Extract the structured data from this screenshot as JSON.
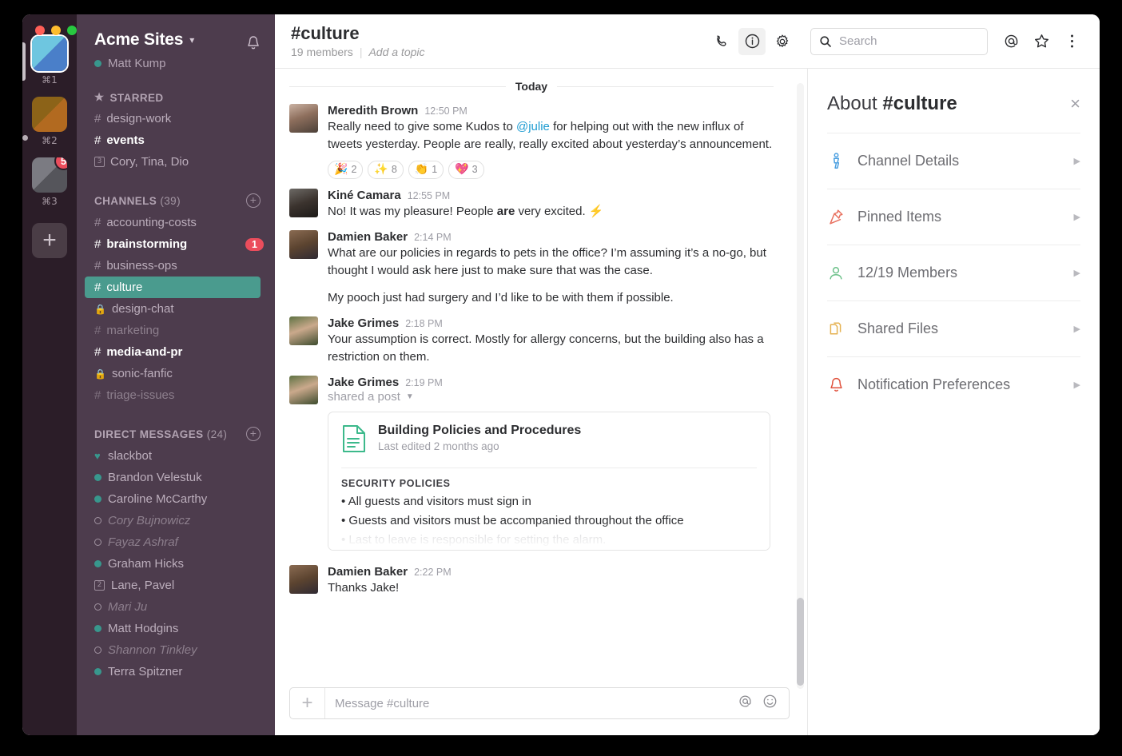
{
  "window": {
    "traffic_lights": [
      {
        "name": "close",
        "color": "#ff5f57"
      },
      {
        "name": "minimize",
        "color": "#febc2e"
      },
      {
        "name": "zoom",
        "color": "#28c840"
      }
    ]
  },
  "rail": {
    "workspaces": [
      {
        "name": "workspace-1",
        "shortcut": "⌘1",
        "color_a": "#6ec6e0",
        "color_b": "#4a7fc9",
        "selected": true,
        "badge": null
      },
      {
        "name": "workspace-2",
        "shortcut": "⌘2",
        "color_a": "#8c6318",
        "color_b": "#b26a20",
        "selected": false,
        "badge": null
      },
      {
        "name": "workspace-3",
        "shortcut": "⌘3",
        "color_a": "#7b7b82",
        "color_b": "#55555b",
        "selected": false,
        "badge": "5"
      }
    ],
    "add_label": "+"
  },
  "sidebar": {
    "team_name": "Acme Sites",
    "team_caret": "⌄",
    "bell_icon": "bell-icon",
    "user_name": "Matt Kump",
    "starred": {
      "label": "STARRED",
      "items": [
        {
          "sigil": "#",
          "label": "design-work",
          "state": "normal",
          "badge": null
        },
        {
          "sigil": "#",
          "label": "events",
          "state": "unread",
          "badge": null
        },
        {
          "sigil": "3",
          "label": "Cory, Tina, Dio",
          "state": "group",
          "badge": null
        }
      ]
    },
    "channels": {
      "label": "CHANNELS",
      "count": "(39)",
      "add_label": "+",
      "items": [
        {
          "sigil": "#",
          "label": "accounting-costs",
          "state": "normal",
          "badge": null
        },
        {
          "sigil": "#",
          "label": "brainstorming",
          "state": "unread",
          "badge": "1"
        },
        {
          "sigil": "#",
          "label": "business-ops",
          "state": "normal",
          "badge": null
        },
        {
          "sigil": "#",
          "label": "culture",
          "state": "active",
          "badge": null
        },
        {
          "sigil": "lock",
          "label": "design-chat",
          "state": "normal",
          "badge": null
        },
        {
          "sigil": "#",
          "label": "marketing",
          "state": "muted",
          "badge": null
        },
        {
          "sigil": "#",
          "label": "media-and-pr",
          "state": "unread",
          "badge": null
        },
        {
          "sigil": "lock",
          "label": "sonic-fanfic",
          "state": "normal",
          "badge": null
        },
        {
          "sigil": "#",
          "label": "triage-issues",
          "state": "muted",
          "badge": null
        }
      ]
    },
    "direct_messages": {
      "label": "DIRECT MESSAGES",
      "count": "(24)",
      "add_label": "+",
      "items": [
        {
          "label": "slackbot",
          "presence": "heart"
        },
        {
          "label": "Brandon Velestuk",
          "presence": "online"
        },
        {
          "label": "Caroline McCarthy",
          "presence": "online"
        },
        {
          "label": "Cory Bujnowicz",
          "presence": "away"
        },
        {
          "label": "Fayaz Ashraf",
          "presence": "away"
        },
        {
          "label": "Graham Hicks",
          "presence": "online"
        },
        {
          "label": "Lane, Pavel",
          "presence": "group2"
        },
        {
          "label": "Mari Ju",
          "presence": "away"
        },
        {
          "label": "Matt Hodgins",
          "presence": "online"
        },
        {
          "label": "Shannon Tinkley",
          "presence": "away"
        },
        {
          "label": "Terra Spitzner",
          "presence": "online"
        }
      ]
    }
  },
  "header": {
    "channel_title": "#culture",
    "members_text": "19 members",
    "separator": "|",
    "topic_placeholder": "Add a topic",
    "icons": [
      "phone-icon",
      "info-icon",
      "gear-icon"
    ],
    "search_placeholder": "Search",
    "right_icons": [
      "at-icon",
      "star-icon",
      "kebab-menu-icon"
    ]
  },
  "messages": {
    "day_divider": "Today",
    "items": [
      {
        "author": "Meredith Brown",
        "time": "12:50 PM",
        "avatar_kind": "meredith",
        "paragraphs": [
          [
            {
              "t": "Really need to give some Kudos to ",
              "k": "plain"
            },
            {
              "t": "@julie",
              "k": "mention"
            },
            {
              "t": " for helping out with the new influx of tweets yesterday. People are really, really excited about yesterday’s announcement.",
              "k": "plain"
            }
          ]
        ],
        "reactions": [
          {
            "emoji": "🎉",
            "count": "2"
          },
          {
            "emoji": "✨",
            "count": "8"
          },
          {
            "emoji": "👏",
            "count": "1"
          },
          {
            "emoji": "💖",
            "count": "3"
          }
        ]
      },
      {
        "author": "Kiné Camara",
        "time": "12:55 PM",
        "avatar_kind": "kine",
        "paragraphs": [
          [
            {
              "t": "No! It was my pleasure! People ",
              "k": "plain"
            },
            {
              "t": "are",
              "k": "bold"
            },
            {
              "t": " very excited. ⚡",
              "k": "plain"
            }
          ]
        ],
        "reactions": []
      },
      {
        "author": "Damien Baker",
        "time": "2:14 PM",
        "avatar_kind": "damien",
        "paragraphs": [
          [
            {
              "t": "What are our policies in regards to pets in the office? I’m assuming it’s a no-go, but thought I would ask here just to make sure that was the case.",
              "k": "plain"
            }
          ],
          [
            {
              "t": "My pooch just had surgery and I’d like to be with them if possible.",
              "k": "plain"
            }
          ]
        ],
        "reactions": []
      },
      {
        "author": "Jake Grimes",
        "time": "2:18 PM",
        "avatar_kind": "jake",
        "paragraphs": [
          [
            {
              "t": "Your assumption is correct. Mostly for allergy concerns, but the building also has a restriction on them.",
              "k": "plain"
            }
          ]
        ],
        "reactions": []
      }
    ],
    "shared_post_message": {
      "author": "Jake Grimes",
      "time": "2:19 PM",
      "avatar_kind": "jake",
      "shared_label": "shared a post",
      "card": {
        "doc_icon": "document-icon",
        "title": "Building Policies and Procedures",
        "subtitle": "Last edited 2 months ago",
        "kicker": "SECURITY POLICIES",
        "bullets": [
          {
            "text": "• All guests and visitors must sign in",
            "faded": false
          },
          {
            "text": "• Guests and visitors must be accompanied throughout the office",
            "faded": false
          },
          {
            "text": "• Last to leave is responsible for setting the alarm.",
            "faded": true
          }
        ]
      }
    },
    "last_message": {
      "author": "Damien Baker",
      "time": "2:22 PM",
      "avatar_kind": "damien",
      "text": "Thanks Jake!"
    }
  },
  "composer": {
    "plus_label": "+",
    "placeholder": "Message #culture",
    "icons": [
      "at-icon",
      "emoji-icon"
    ]
  },
  "details_panel": {
    "title_prefix": "About ",
    "title_channel": "#culture",
    "close_label": "×",
    "rows": [
      {
        "icon": "channel-details-icon",
        "label": "Channel Details",
        "color": "#4b9fe0",
        "chevron": "▶"
      },
      {
        "icon": "pin-icon",
        "label": "Pinned Items",
        "color": "#e8705f",
        "chevron": "▶"
      },
      {
        "icon": "members-icon",
        "label": "12/19 Members",
        "color": "#6dc18a",
        "chevron": "▶"
      },
      {
        "icon": "files-icon",
        "label": "Shared Files",
        "color": "#e5b252",
        "chevron": "▶"
      },
      {
        "icon": "bell-icon",
        "label": "Notification Preferences",
        "color": "#e0513c",
        "chevron": "▶"
      }
    ]
  },
  "colors": {
    "sidebar_bg": "#4d3c4d",
    "rail_bg": "#2b1d28",
    "active_channel": "#4a9b8e",
    "badge_red": "#eb4d5c",
    "mention_blue": "#1d9bd1"
  }
}
